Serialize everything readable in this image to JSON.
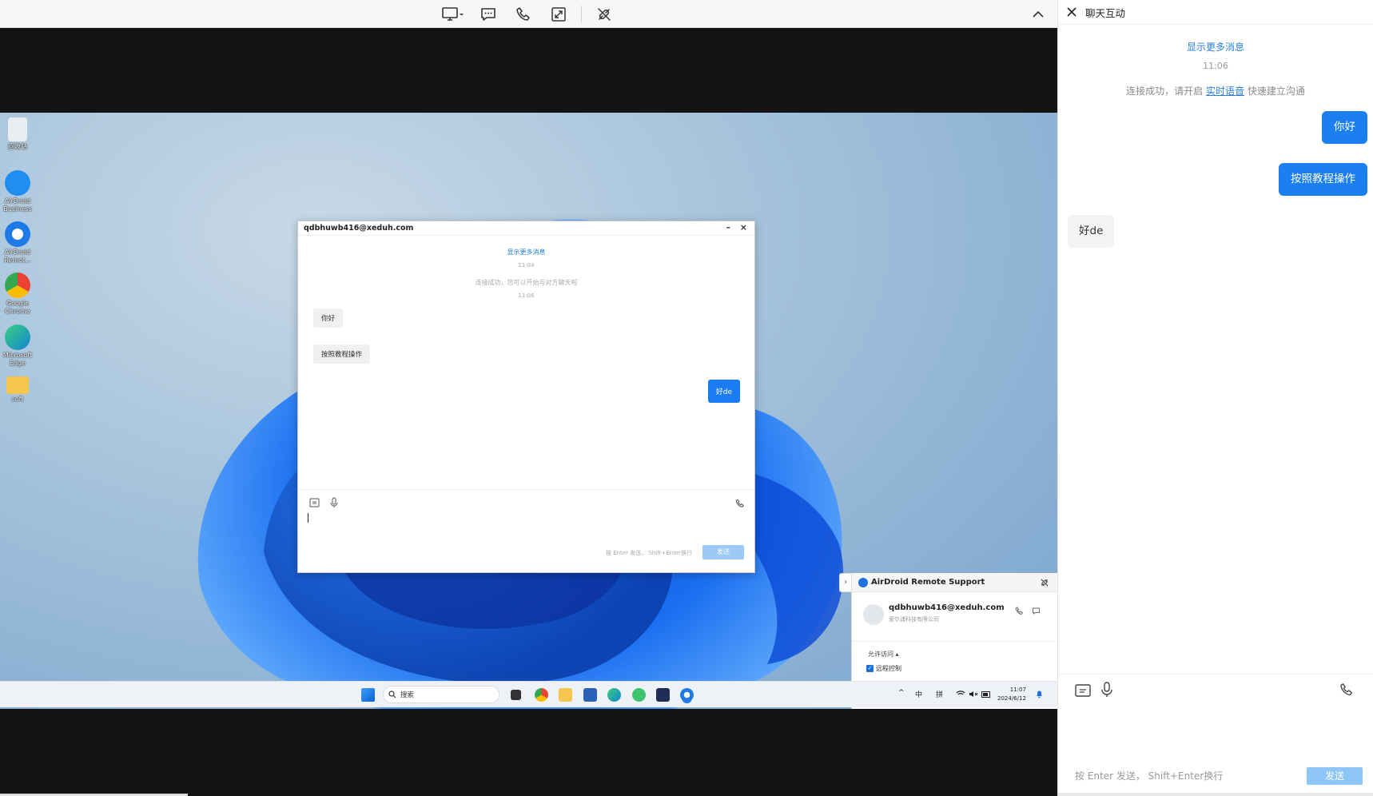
{
  "toolbar": {
    "icons": [
      "monitor-select-icon",
      "chat-icon",
      "phone-icon",
      "fullscreen-icon",
      "disconnect-icon"
    ],
    "collapse_icon": "chevron-up-icon"
  },
  "desktop": {
    "icons": [
      {
        "name": "recycle-bin",
        "label": "回收站"
      },
      {
        "name": "airdroid-business",
        "label": "AirDroid Business"
      },
      {
        "name": "airdroid-remote",
        "label": "AirDroid Remot..."
      },
      {
        "name": "google-chrome",
        "label": "Google Chrome"
      },
      {
        "name": "microsoft-edge",
        "label": "Microsoft Edge"
      },
      {
        "name": "soft-folder",
        "label": "soft"
      }
    ]
  },
  "inner_chat": {
    "title": "qdbhuwb416@xeduh.com",
    "minimize": "–",
    "close": "×",
    "show_more": "显示更多消息",
    "time1": "11:04",
    "system": "连接成功，您可以开始与对方聊天啦",
    "time2": "11:06",
    "messages": [
      {
        "side": "left",
        "text": "你好"
      },
      {
        "side": "left",
        "text": "按照教程操作"
      },
      {
        "side": "right",
        "text": "好de"
      }
    ],
    "hint": "按 Enter 发送，  Shift+Enter换行",
    "send": "发送"
  },
  "airdroid_panel": {
    "expand": "›",
    "title": "AirDroid Remote Support",
    "email": "qdbhuwb416@xeduh.com",
    "org": "爱尔浦科技有限公司",
    "allow_label": "允许访问 ▴",
    "remote_control": "远程控制"
  },
  "taskbar": {
    "search_placeholder": "搜索",
    "ime1": "中",
    "ime2": "拼",
    "time": "11:07",
    "date": "2024/6/12",
    "up": "^"
  },
  "sidebar": {
    "title": "聊天互动",
    "show_more": "显示更多消息",
    "time": "11:06",
    "system_pre": "连接成功，请开启",
    "system_link": "实时语音",
    "system_post": "快速建立沟通",
    "messages": [
      {
        "side": "right",
        "text": "你好"
      },
      {
        "side": "right",
        "text": "按照教程操作"
      },
      {
        "side": "left",
        "text": "好de"
      }
    ],
    "hint": "按 Enter 发送，  Shift+Enter换行",
    "send": "发送"
  },
  "colors": {
    "accent": "#1b7ff0",
    "link": "#2a7fe0",
    "send_disabled": "#8dc6f7"
  }
}
